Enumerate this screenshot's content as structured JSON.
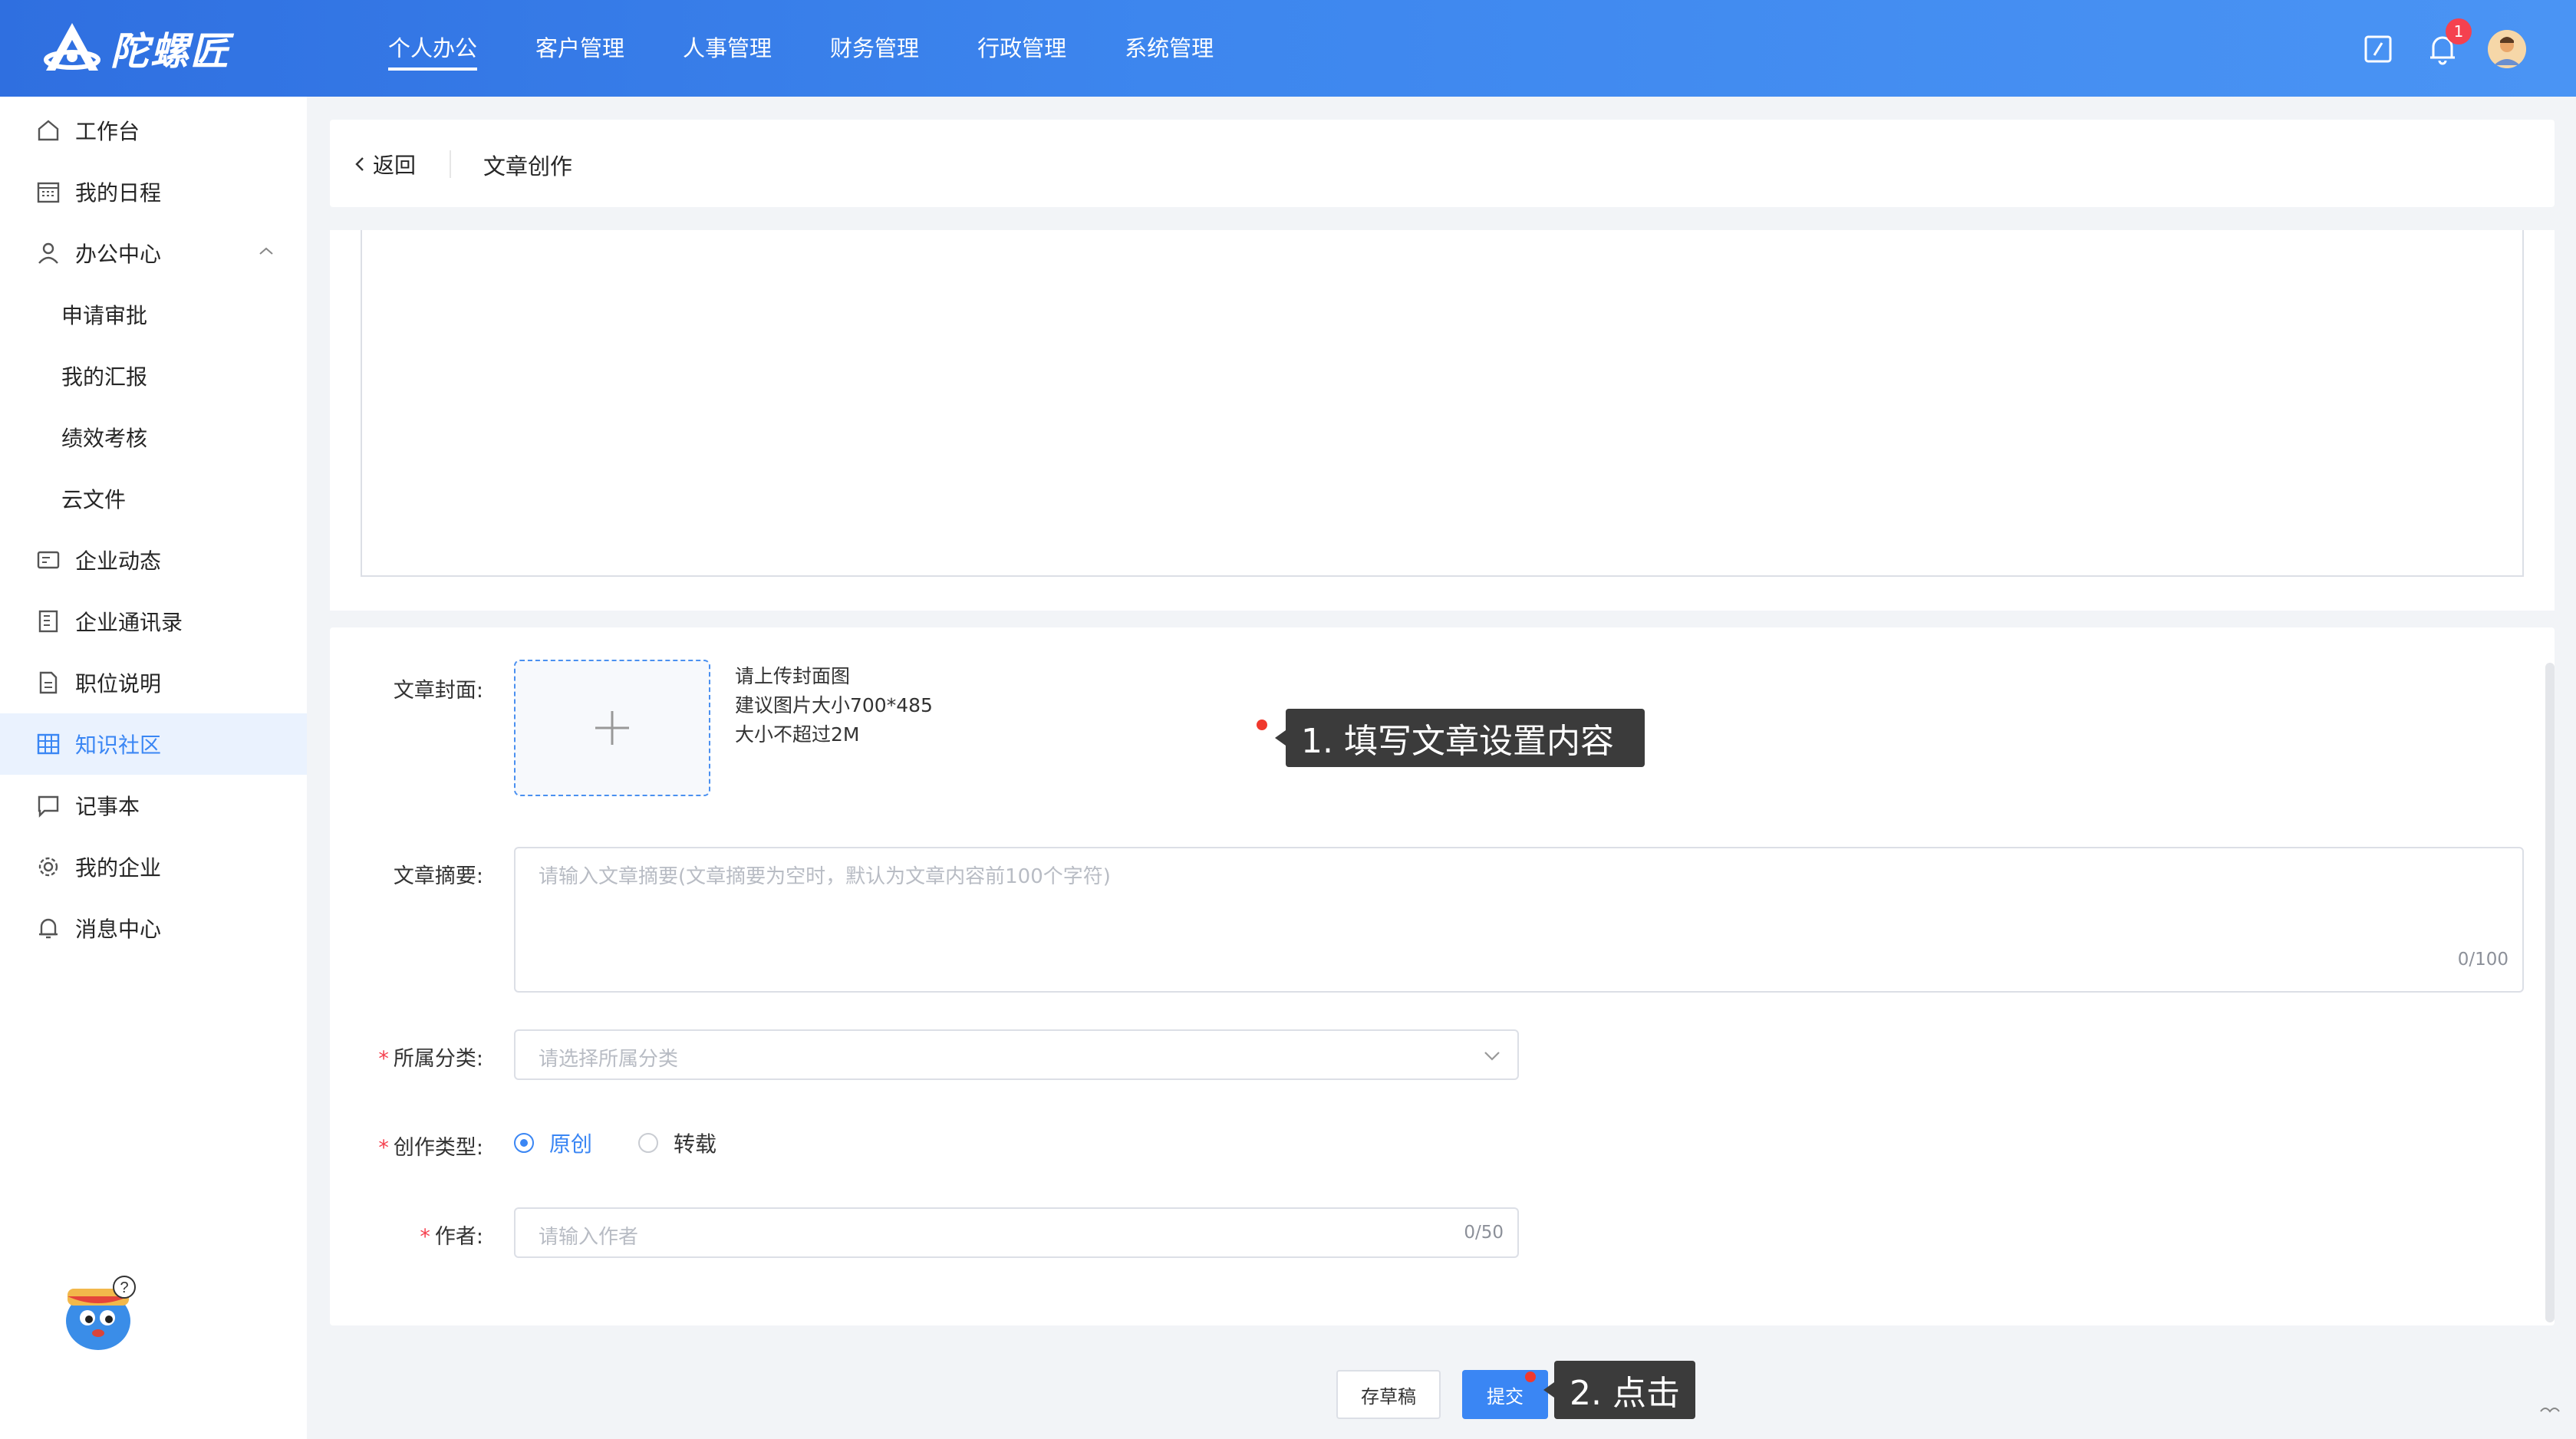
{
  "header": {
    "brand": "陀螺匠",
    "nav": [
      "个人办公",
      "客户管理",
      "人事管理",
      "财务管理",
      "行政管理",
      "系统管理"
    ],
    "active_nav": "个人办公",
    "notification_count": "1"
  },
  "sidebar": {
    "items": [
      {
        "label": "工作台",
        "icon": "home-icon"
      },
      {
        "label": "我的日程",
        "icon": "calendar-icon"
      },
      {
        "label": "办公中心",
        "icon": "user-icon"
      },
      {
        "label": "申请审批"
      },
      {
        "label": "我的汇报"
      },
      {
        "label": "绩效考核"
      },
      {
        "label": "云文件"
      },
      {
        "label": "企业动态",
        "icon": "news-icon"
      },
      {
        "label": "企业通讯录",
        "icon": "contacts-icon"
      },
      {
        "label": "职位说明",
        "icon": "document-icon"
      },
      {
        "label": "知识社区",
        "icon": "grid-icon"
      },
      {
        "label": "记事本",
        "icon": "chat-icon"
      },
      {
        "label": "我的企业",
        "icon": "gear-icon"
      },
      {
        "label": "消息中心",
        "icon": "bell-icon"
      }
    ],
    "active": "知识社区"
  },
  "breadcrumb": {
    "back": "返回",
    "title": "文章创作"
  },
  "form": {
    "cover": {
      "label": "文章封面:",
      "hints": [
        "请上传封面图",
        "建议图片大小700*485",
        "大小不超过2M"
      ]
    },
    "summary": {
      "label": "文章摘要:",
      "placeholder": "请输入文章摘要(文章摘要为空时，默认为文章内容前100个字符)",
      "counter": "0/100"
    },
    "category": {
      "label": "所属分类:",
      "placeholder": "请选择所属分类"
    },
    "type": {
      "label": "创作类型:",
      "options": [
        "原创",
        "转载"
      ],
      "selected": "原创"
    },
    "author": {
      "label": "作者:",
      "placeholder": "请输入作者",
      "counter": "0/50"
    }
  },
  "actions": {
    "draft": "存草稿",
    "submit": "提交"
  },
  "annotations": {
    "step1": "1. 填写文章设置内容",
    "step2": "2. 点击"
  },
  "colors": {
    "primary": "#3a86f4",
    "header_start": "#2f6fe0",
    "header_end": "#4a94f4",
    "required": "#f5414f",
    "marker": "#f0382d"
  }
}
